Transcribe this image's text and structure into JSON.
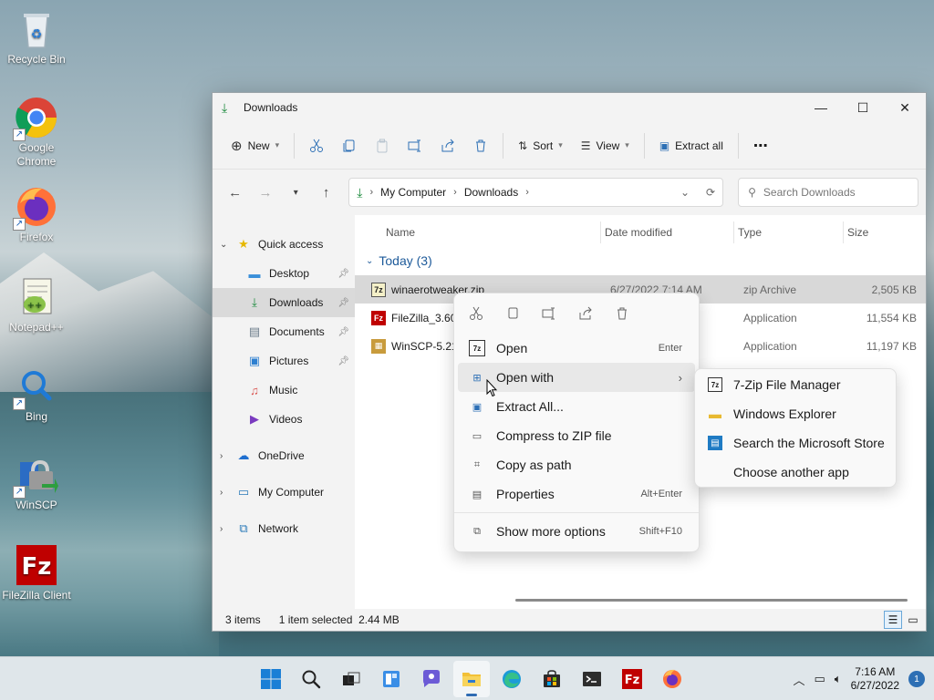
{
  "desktop": {
    "icons": [
      {
        "label": "Recycle Bin",
        "icon": "recycle-bin-icon"
      },
      {
        "label": "Google Chrome",
        "icon": "chrome-icon"
      },
      {
        "label": "Firefox",
        "icon": "firefox-icon"
      },
      {
        "label": "Notepad++",
        "icon": "notepadpp-icon"
      },
      {
        "label": "Bing",
        "icon": "bing-icon"
      },
      {
        "label": "WinSCP",
        "icon": "winscp-icon"
      },
      {
        "label": "FileZilla Client",
        "icon": "filezilla-icon"
      }
    ]
  },
  "window": {
    "title": "Downloads",
    "toolbar": {
      "new_label": "New",
      "sort_label": "Sort",
      "view_label": "View",
      "extract_label": "Extract all"
    },
    "address": {
      "crumbs": [
        "My Computer",
        "Downloads"
      ],
      "search_placeholder": "Search Downloads"
    },
    "nav": {
      "quick_access": "Quick access",
      "items": [
        "Desktop",
        "Downloads",
        "Documents",
        "Pictures",
        "Music",
        "Videos"
      ],
      "onedrive": "OneDrive",
      "my_computer": "My Computer",
      "network": "Network"
    },
    "columns": {
      "name": "Name",
      "date": "Date modified",
      "type": "Type",
      "size": "Size"
    },
    "group": "Today (3)",
    "files": [
      {
        "name": "winaerotweaker.zip",
        "date": "6/27/2022 7:14 AM",
        "type": "zip Archive",
        "size": "2,505 KB"
      },
      {
        "name": "FileZilla_3.60",
        "date": "",
        "type": "Application",
        "size": "11,554 KB"
      },
      {
        "name": "WinSCP-5.21",
        "date": "",
        "type": "Application",
        "size": "11,197 KB"
      }
    ],
    "status": {
      "count": "3 items",
      "selected": "1 item selected  2.44 MB"
    }
  },
  "context_menu": {
    "items": [
      {
        "label": "Open",
        "shortcut": "Enter"
      },
      {
        "label": "Open with",
        "shortcut": ""
      },
      {
        "label": "Extract All...",
        "shortcut": ""
      },
      {
        "label": "Compress to ZIP file",
        "shortcut": ""
      },
      {
        "label": "Copy as path",
        "shortcut": ""
      },
      {
        "label": "Properties",
        "shortcut": "Alt+Enter"
      },
      {
        "label": "Show more options",
        "shortcut": "Shift+F10"
      }
    ]
  },
  "open_with_submenu": {
    "items": [
      "7-Zip File Manager",
      "Windows Explorer",
      "Search the Microsoft Store",
      "Choose another app"
    ]
  },
  "taskbar": {
    "time": "7:16 AM",
    "date": "6/27/2022",
    "notifications": "1",
    "accent": "#2f6bb3"
  }
}
